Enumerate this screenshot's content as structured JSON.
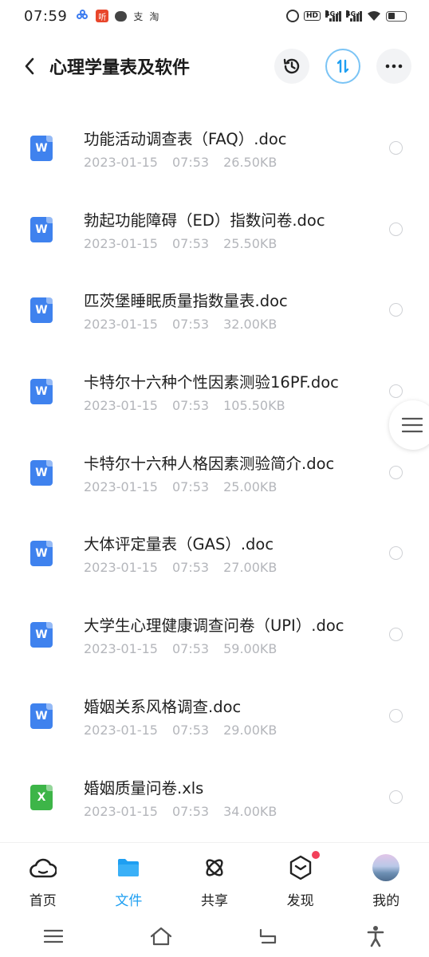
{
  "status_bar": {
    "time": "07:59",
    "app_icons": [
      "baidu-netdisk-icon",
      "listen-app-icon",
      "chat-bubble-icon",
      "alipay-icon",
      "taobao-icon"
    ],
    "alipay_label": "支",
    "taobao_label": "淘",
    "listen_label": "听",
    "hd_label": "HD",
    "signal_labels": [
      "4G+",
      "4G+"
    ]
  },
  "header": {
    "title": "心理学量表及软件",
    "actions": [
      "history-icon",
      "sort-icon",
      "more-icon"
    ]
  },
  "files": [
    {
      "name": "功能活动调查表（FAQ）.doc",
      "date": "2023-01-15",
      "time": "07:53",
      "size": "26.50KB",
      "type": "doc",
      "icon_letter": "W"
    },
    {
      "name": "勃起功能障碍（ED）指数问卷.doc",
      "date": "2023-01-15",
      "time": "07:53",
      "size": "25.50KB",
      "type": "doc",
      "icon_letter": "W"
    },
    {
      "name": "匹茨堡睡眠质量指数量表.doc",
      "date": "2023-01-15",
      "time": "07:53",
      "size": "32.00KB",
      "type": "doc",
      "icon_letter": "W"
    },
    {
      "name": "卡特尔十六种个性因素测验16PF.doc",
      "date": "2023-01-15",
      "time": "07:53",
      "size": "105.50KB",
      "type": "doc",
      "icon_letter": "W"
    },
    {
      "name": "卡特尔十六种人格因素测验简介.doc",
      "date": "2023-01-15",
      "time": "07:53",
      "size": "25.00KB",
      "type": "doc",
      "icon_letter": "W"
    },
    {
      "name": "大体评定量表（GAS）.doc",
      "date": "2023-01-15",
      "time": "07:53",
      "size": "27.00KB",
      "type": "doc",
      "icon_letter": "W"
    },
    {
      "name": "大学生心理健康调查问卷（UPI）.doc",
      "date": "2023-01-15",
      "time": "07:53",
      "size": "59.00KB",
      "type": "doc",
      "icon_letter": "W"
    },
    {
      "name": "婚姻关系风格调查.doc",
      "date": "2023-01-15",
      "time": "07:53",
      "size": "29.00KB",
      "type": "doc",
      "icon_letter": "W"
    },
    {
      "name": "婚姻质量问卷.xls",
      "date": "2023-01-15",
      "time": "07:53",
      "size": "34.00KB",
      "type": "xls",
      "icon_letter": "X"
    }
  ],
  "bottom_nav": [
    {
      "label": "首页",
      "icon": "cloud-home-icon",
      "active": false
    },
    {
      "label": "文件",
      "icon": "folder-icon",
      "active": true
    },
    {
      "label": "共享",
      "icon": "atom-share-icon",
      "active": false
    },
    {
      "label": "发现",
      "icon": "cube-discover-icon",
      "active": false,
      "badge": true
    },
    {
      "label": "我的",
      "icon": "avatar",
      "active": false
    }
  ],
  "colors": {
    "accent": "#1e9ff2",
    "doc_icon": "#3f82ee",
    "xls_icon": "#3db548",
    "meta_text": "#b4b6bb",
    "badge": "#f2405a"
  }
}
